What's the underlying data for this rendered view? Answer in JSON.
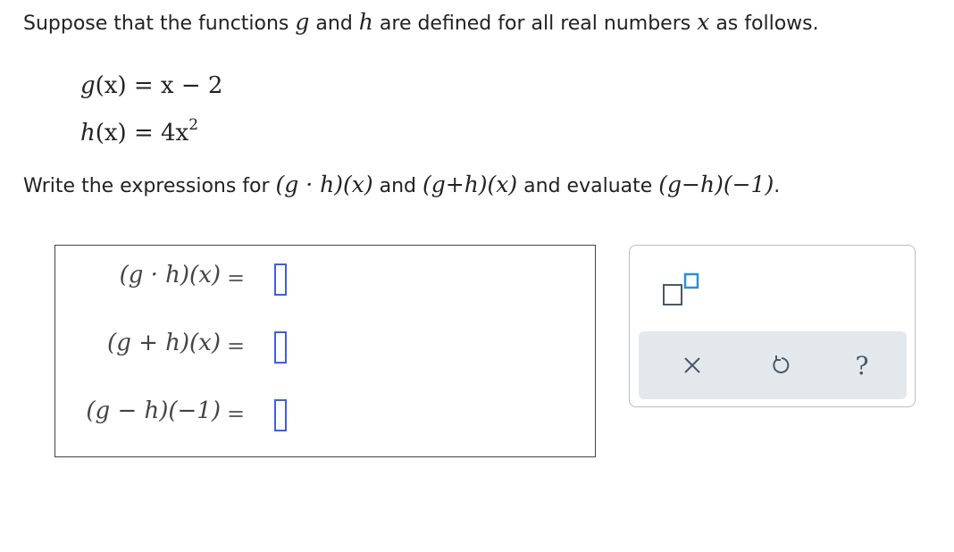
{
  "intro": {
    "part1": "Suppose that the functions ",
    "g": "g",
    "and": " and ",
    "h": "h",
    "part2": " are defined for all real numbers ",
    "x": "x",
    "part3": " as follows."
  },
  "definitions": {
    "g_lhs": "g",
    "g_arg": "(x)",
    "g_rhs": " = x − 2",
    "h_lhs": "h",
    "h_arg": "(x)",
    "h_rhs": " = 4x",
    "h_exp": "2"
  },
  "prompt": {
    "write": "Write the expressions for ",
    "expr1": "(g · h)(x)",
    "and": " and ",
    "expr2": "(g+h)(x)",
    "evaluate": " and evaluate ",
    "expr3": "(g−h)(−1)",
    "period": "."
  },
  "answers": [
    {
      "expr": "(g · h)(x)",
      "eq": "="
    },
    {
      "expr": "(g + h)(x)",
      "eq": "="
    },
    {
      "expr": "(g − h)(−1)",
      "eq": "="
    }
  ],
  "tools": {
    "exponent_tool_icon": "superscript-template-icon",
    "clear_icon": "close-icon",
    "undo_icon": "undo-icon",
    "help_icon": "help-icon",
    "clear_label": "×",
    "help_label": "?"
  },
  "colors": {
    "slot_border": "#3d5ee8",
    "action_bar": "#e3e8ec",
    "icon": "#4a5866"
  }
}
